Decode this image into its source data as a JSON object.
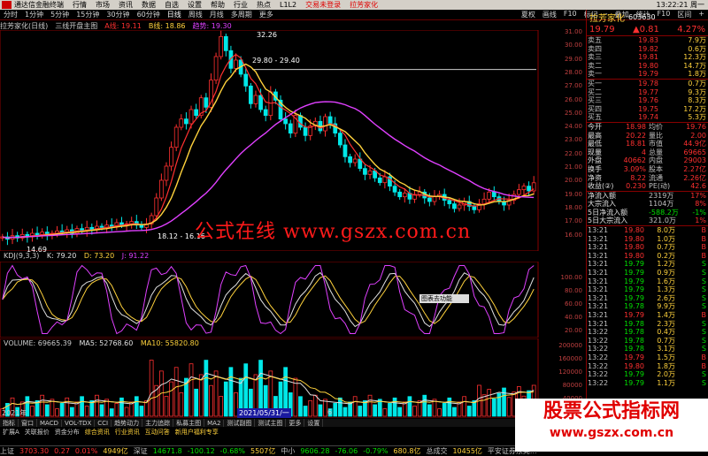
{
  "app": {
    "broker": "通达信金融终端",
    "menus": [
      "行情",
      "市场",
      "资讯",
      "数据",
      "自选",
      "设置",
      "帮助",
      "行业",
      "热点",
      "L1L2"
    ],
    "notice": "交易未登录",
    "stock_title": "拉芳家化",
    "clock": "13:22:21 周一"
  },
  "toolbar": {
    "periods": [
      "分时",
      "1分钟",
      "5分钟",
      "15分钟",
      "30分钟",
      "60分钟",
      "日线",
      "周线",
      "月线",
      "多周期",
      "更多"
    ],
    "right_items": [
      "夏权",
      "画线",
      "F10",
      "标记",
      "-",
      "叠加",
      "统计",
      "F10",
      "区间",
      "+"
    ]
  },
  "title_line": {
    "name": "拉芳家化(日线)",
    "template": "三线开盘主图",
    "a_label": "A线: 19.11",
    "b_label": "B线: 18.86",
    "c_label": "趋势: 19.30"
  },
  "main_axis": [
    "31.00",
    "30.00",
    "29.00",
    "28.00",
    "27.00",
    "26.00",
    "25.00",
    "24.00",
    "23.00",
    "22.00",
    "21.00",
    "20.00",
    "19.00",
    "18.00",
    "17.00",
    "16.00"
  ],
  "annotations": {
    "high": "32.26",
    "mid": "29.80 - 29.40",
    "low": "18.12 - 16.16",
    "start": "14.69"
  },
  "kdj": {
    "label": "KDJ(9,3,3)",
    "k": "K: 79.20",
    "d": "D: 73.20",
    "j": "J: 91.22",
    "axis": [
      "100.00",
      "80.00",
      "60.00",
      "40.00",
      "20.00"
    ],
    "popup": "图表去功能"
  },
  "volume": {
    "label": "VOLUME: 69665.39",
    "ma5": "MA5: 52768.60",
    "ma10": "MA10: 55820.80",
    "axis": [
      "200000",
      "160000",
      "120000",
      "80000",
      "40000"
    ],
    "date_hl": "2021/05/31/一",
    "year": "2021年",
    "month": "6"
  },
  "tabs": [
    "指标",
    "窗口",
    "MACD",
    "VOL-TDX",
    "CCI",
    "趋势动力",
    "主力追踪",
    "私募主图",
    "MA2",
    "测试副图",
    "测试主图",
    "更多",
    "设置"
  ],
  "tabs2": [
    "扩展A",
    "关联报价",
    "资金分布",
    "综合资讯",
    "行业资讯",
    "互动问答",
    "新用户福利专享"
  ],
  "status": [
    {
      "name": "上证",
      "val": "3703.30",
      "chg": "0.27",
      "pct": "0.01%",
      "amt": "4949亿"
    },
    {
      "name": "深证",
      "val": "14671.8",
      "chg": "-100.12",
      "pct": "-0.68%",
      "amt": "5507亿"
    },
    {
      "name": "中小",
      "val": "9606.28",
      "chg": "-76.06",
      "pct": "-0.79%",
      "amt": "680.8亿"
    }
  ],
  "status_extra": [
    "总成交",
    "10455亿",
    "平安证券东莞..."
  ],
  "right": {
    "name": "拉芳家化",
    "code": "603630",
    "price": "19.79",
    "change": "▲0.81",
    "pct": "4.27%",
    "asks": [
      {
        "l": "卖五",
        "p": "19.83",
        "v": "7.9万"
      },
      {
        "l": "卖四",
        "p": "19.82",
        "v": "0.6万"
      },
      {
        "l": "卖三",
        "p": "19.81",
        "v": "12.3万"
      },
      {
        "l": "卖二",
        "p": "19.80",
        "v": "14.7万"
      },
      {
        "l": "卖一",
        "p": "19.79",
        "v": "1.8万"
      }
    ],
    "bids": [
      {
        "l": "买一",
        "p": "19.78",
        "v": "0.7万"
      },
      {
        "l": "买二",
        "p": "19.77",
        "v": "9.3万"
      },
      {
        "l": "买三",
        "p": "19.76",
        "v": "8.3万"
      },
      {
        "l": "买四",
        "p": "19.75",
        "v": "17.2万"
      },
      {
        "l": "买五",
        "p": "19.74",
        "v": "5.3万"
      }
    ],
    "info": [
      [
        "今开",
        "18.98",
        "均价",
        "19.76"
      ],
      [
        "最高",
        "20.22",
        "量比",
        "2.00"
      ],
      [
        "最低",
        "18.81",
        "市值",
        "44.9亿"
      ],
      [
        "现量",
        "4",
        "总量",
        "69665"
      ],
      [
        "外盘",
        "40662",
        "内盘",
        "29003"
      ],
      [
        "换手",
        "3.09%",
        "股本",
        "2.27亿"
      ],
      [
        "净资",
        "8.22",
        "流通",
        "2.26亿"
      ],
      [
        "收益(②)",
        "0.230",
        "PE(动)",
        "42.6"
      ]
    ],
    "flows": [
      {
        "l": "净流入额",
        "v": "2319万",
        "p": "17%"
      },
      {
        "l": "大宗流入",
        "v": "1104万",
        "p": "8%"
      },
      {
        "l": "5日净流入额",
        "v": "-588.2万",
        "p": "-1%"
      },
      {
        "l": "5日大宗流入",
        "v": "321.0万",
        "p": "1%"
      }
    ],
    "ticks": [
      [
        "13:21",
        "19.80",
        "8.0万",
        "B"
      ],
      [
        "13:21",
        "19.80",
        "1.0万",
        "B"
      ],
      [
        "13:21",
        "19.80",
        "0.7万",
        "B"
      ],
      [
        "13:21",
        "19.80",
        "0.2万",
        "B"
      ],
      [
        "13:21",
        "19.79",
        "1.2万",
        "S"
      ],
      [
        "13:21",
        "19.79",
        "0.9万",
        "S"
      ],
      [
        "13:21",
        "19.79",
        "1.6万",
        "S"
      ],
      [
        "13:21",
        "19.79",
        "1.3万",
        "S"
      ],
      [
        "13:21",
        "19.79",
        "2.6万",
        "S"
      ],
      [
        "13:21",
        "19.78",
        "9.9万",
        "S"
      ],
      [
        "13:21",
        "19.79",
        "1.4万",
        "B"
      ],
      [
        "13:21",
        "19.78",
        "2.3万",
        "S"
      ],
      [
        "13:22",
        "19.78",
        "0.4万",
        "S"
      ],
      [
        "13:22",
        "19.78",
        "0.7万",
        "S"
      ],
      [
        "13:22",
        "19.78",
        "3.1万",
        "S"
      ],
      [
        "13:22",
        "19.79",
        "1.5万",
        "B"
      ],
      [
        "13:22",
        "19.80",
        "1.8万",
        "B"
      ],
      [
        "13:22",
        "19.79",
        "2.0万",
        "S"
      ],
      [
        "13:22",
        "19.79",
        "1.1万",
        "S"
      ]
    ]
  },
  "watermark": {
    "a": "公式在线 www.gszx.com.cn",
    "b": "股票公式指标网",
    "c": "www.gszx.com.cn"
  },
  "chart_data": {
    "type": "candlestick",
    "close": [
      15.2,
      15.0,
      15.3,
      15.1,
      15.4,
      15.2,
      15.5,
      15.3,
      15.6,
      15.4,
      15.5,
      15.7,
      15.6,
      15.8,
      15.5,
      15.9,
      15.7,
      16.0,
      15.8,
      16.1,
      16.0,
      16.2,
      16.1,
      16.4,
      16.2,
      16.3,
      16.5,
      16.2,
      16.0,
      16.3,
      17.0,
      18.5,
      20.0,
      21.2,
      22.8,
      24.5,
      25.2,
      24.8,
      26.0,
      25.5,
      27.0,
      26.2,
      28.5,
      30.5,
      32.2,
      31.0,
      29.5,
      30.2,
      29.0,
      28.0,
      26.5,
      27.2,
      26.0,
      25.5,
      27.5,
      26.8,
      25.2,
      24.8,
      24.0,
      25.5,
      24.5,
      23.8,
      24.6,
      25.0,
      24.2,
      25.4,
      24.8,
      24.0,
      23.0,
      22.0,
      21.5,
      21.8,
      21.0,
      20.5,
      20.8,
      20.2,
      19.8,
      20.3,
      19.5,
      19.0,
      18.6,
      18.9,
      18.4,
      18.8,
      19.0,
      18.5,
      18.2,
      18.6,
      18.8,
      18.3,
      18.0,
      17.6,
      17.9,
      18.2,
      17.8,
      17.5,
      18.0,
      18.4,
      19.0,
      18.6,
      18.2,
      17.9,
      18.3,
      18.8,
      19.2,
      19.5,
      19.1,
      19.79
    ]
  }
}
